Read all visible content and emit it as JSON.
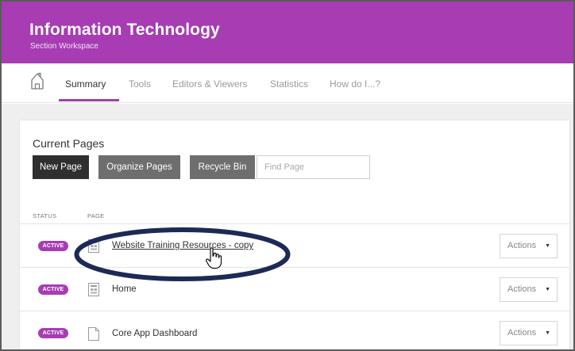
{
  "header": {
    "title": "Information Technology",
    "subtitle": "Section Workspace",
    "brand_color": "#a73cb3"
  },
  "nav": {
    "home_icon": "home-icon",
    "tabs": [
      {
        "label": "Summary",
        "active": true
      },
      {
        "label": "Tools",
        "active": false
      },
      {
        "label": "Editors & Viewers",
        "active": false
      },
      {
        "label": "Statistics",
        "active": false
      },
      {
        "label": "How do I...?",
        "active": false
      }
    ]
  },
  "current_pages": {
    "title": "Current Pages",
    "buttons": {
      "new_page": "New Page",
      "organize_pages": "Organize Pages",
      "recycle_bin": "Recycle Bin"
    },
    "find_placeholder": "Find Page",
    "columns": {
      "status": "STATUS",
      "page": "PAGE"
    },
    "rows": [
      {
        "status": "ACTIVE",
        "name": "Website Training Resources - copy",
        "actions": "Actions",
        "icon": "page-grid-icon"
      },
      {
        "status": "ACTIVE",
        "name": "Home",
        "actions": "Actions",
        "icon": "page-grid-icon"
      },
      {
        "status": "ACTIVE",
        "name": "Core App Dashboard",
        "actions": "Actions",
        "icon": "page-blank-icon"
      }
    ]
  },
  "annotation": {
    "highlight_color": "#1c2a55",
    "cursor_icon": "hand-pointer-icon"
  }
}
